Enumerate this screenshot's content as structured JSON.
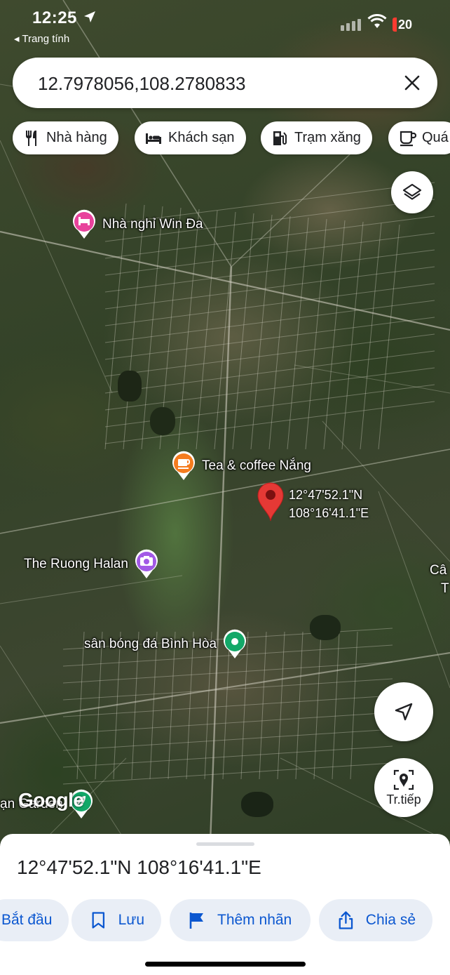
{
  "status_bar": {
    "time": "12:25",
    "back_app": "◂ Trang tính",
    "battery": "20"
  },
  "search": {
    "query": "12.7978056,108.2780833"
  },
  "chips": [
    {
      "label": "Nhà hàng",
      "icon": "restaurant-icon"
    },
    {
      "label": "Khách sạn",
      "icon": "hotel-icon"
    },
    {
      "label": "Trạm xăng",
      "icon": "gas-station-icon"
    },
    {
      "label": "Quá",
      "icon": "coffee-cup-icon"
    }
  ],
  "map": {
    "pois": [
      {
        "label": "Nhà nghỉ Win Đa",
        "icon": "hotel-icon",
        "color": "#e8429c"
      },
      {
        "label": "Tea & coffee Nắng",
        "icon": "coffee-icon",
        "color": "#f57c1f"
      },
      {
        "label": "The Ruong Halan",
        "icon": "camera-icon",
        "color": "#a259e6"
      },
      {
        "label": "sân bóng đá Bình Hòa",
        "icon": "park-dot-icon",
        "color": "#12a868"
      },
      {
        "label": "ạn Garden",
        "icon": "leaf-icon",
        "color": "#12a868"
      }
    ],
    "pin_coord_lat": "12°47'52.1\"N",
    "pin_coord_lng": "108°16'41.1\"E",
    "edge_label_1": "Câ",
    "edge_label_2": "T",
    "logo": "Google",
    "streetview_label": "Tr.tiếp",
    "pin_color": "#e53935"
  },
  "sheet": {
    "title": "12°47'52.1\"N 108°16'41.1\"E",
    "actions": [
      {
        "label": "Bắt đầu",
        "icon": "directions-icon"
      },
      {
        "label": "Lưu",
        "icon": "bookmark-icon"
      },
      {
        "label": "Thêm nhãn",
        "icon": "flag-icon"
      },
      {
        "label": "Chia sẻ",
        "icon": "share-icon"
      }
    ]
  }
}
